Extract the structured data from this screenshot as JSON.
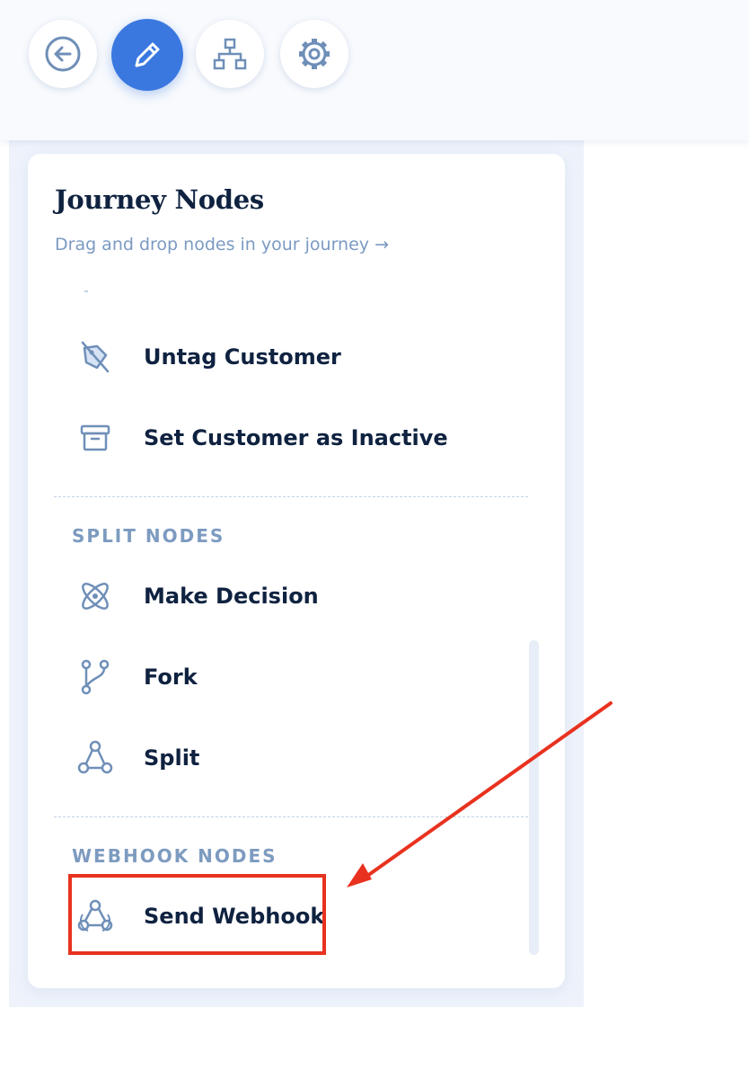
{
  "toolbar": {
    "buttons": [
      {
        "name": "back",
        "icon": "arrow-left-circle-icon",
        "active": false
      },
      {
        "name": "edit",
        "icon": "pencil-icon",
        "active": true
      },
      {
        "name": "structure",
        "icon": "sitemap-icon",
        "active": false
      },
      {
        "name": "settings",
        "icon": "gear-icon",
        "active": false
      }
    ]
  },
  "panel": {
    "title": "Journey Nodes",
    "subtitle": "Drag and drop nodes in your journey →",
    "action_nodes": [
      {
        "label": "Untag Customer",
        "icon": "untag-icon"
      },
      {
        "label": "Set Customer as Inactive",
        "icon": "archive-box-icon"
      }
    ],
    "split_section": {
      "header": "SPLIT NODES",
      "nodes": [
        {
          "label": "Make Decision",
          "icon": "atom-icon"
        },
        {
          "label": "Fork",
          "icon": "git-fork-icon"
        },
        {
          "label": "Split",
          "icon": "split-icon"
        }
      ]
    },
    "webhook_section": {
      "header": "WEBHOOK NODES",
      "nodes": [
        {
          "label": "Send Webhook",
          "icon": "webhook-icon"
        }
      ]
    }
  },
  "colors": {
    "accent": "#3a78e0",
    "icon": "#6f8fb8",
    "text": "#0f2240",
    "muted": "#7b9ac2",
    "annotation": "#e8321f"
  }
}
